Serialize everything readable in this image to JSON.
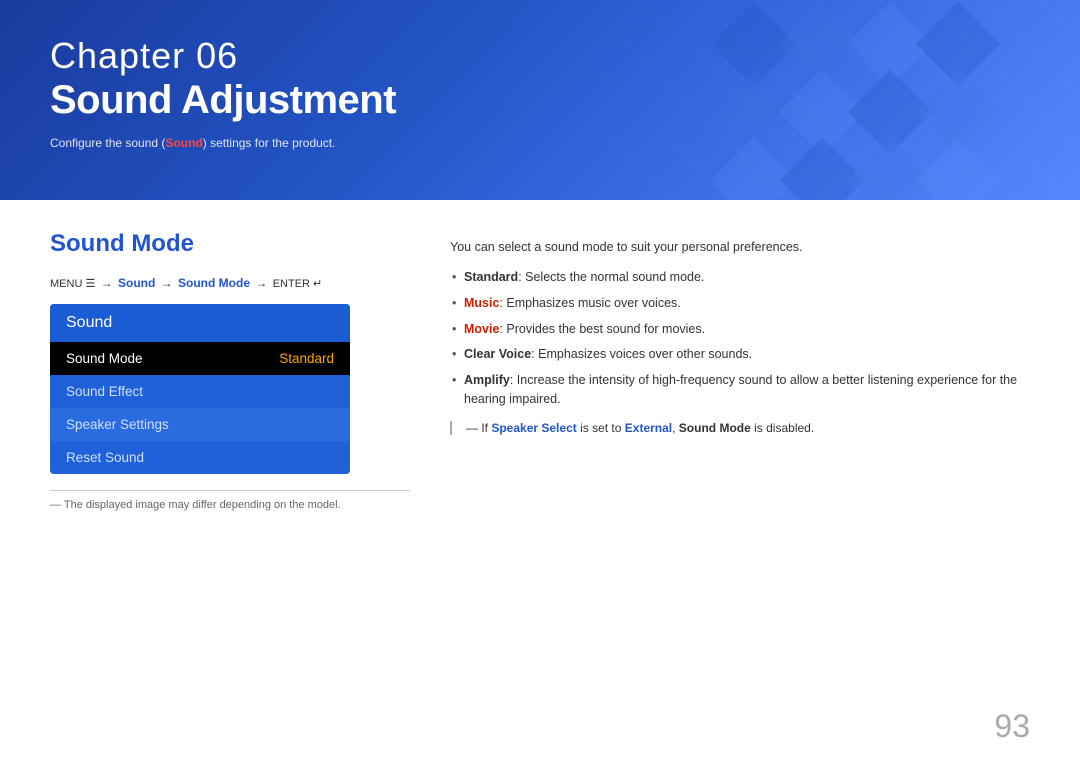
{
  "header": {
    "chapter_label": "Chapter  06",
    "chapter_title": "Sound Adjustment",
    "subtitle_text": "Configure the sound (",
    "subtitle_highlight": "Sound",
    "subtitle_end": ") settings for the product."
  },
  "section": {
    "title": "Sound Mode",
    "menu_path_prefix": "MENU",
    "menu_path_arrow1": "→",
    "menu_path_sound": "Sound",
    "menu_path_arrow2": "→",
    "menu_path_mode": "Sound Mode",
    "menu_path_arrow3": "→",
    "menu_path_enter": "ENTER"
  },
  "tv_menu": {
    "header": "Sound",
    "items": [
      {
        "label": "Sound Mode",
        "value": "Standard",
        "selected": true
      },
      {
        "label": "Sound Effect",
        "value": "",
        "selected": false
      },
      {
        "label": "Speaker Settings",
        "value": "",
        "selected": false
      },
      {
        "label": "Reset Sound",
        "value": "",
        "selected": false
      }
    ]
  },
  "footnote": "The displayed image may differ depending on the model.",
  "right_column": {
    "intro": "You can select a sound mode to suit your personal preferences.",
    "bullets": [
      {
        "term": "Standard",
        "term_style": "bold",
        "text": ": Selects the normal sound mode."
      },
      {
        "term": "Music",
        "term_style": "red",
        "text": ": Emphasizes music over voices."
      },
      {
        "term": "Movie",
        "term_style": "red",
        "text": ": Provides the best sound for movies."
      },
      {
        "term": "Clear Voice",
        "term_style": "bold",
        "text": ": Emphasizes voices over other sounds."
      },
      {
        "term": "Amplify",
        "term_style": "bold",
        "text": ": Increase the intensity of high-frequency sound to allow a better listening experience for the hearing impaired."
      }
    ],
    "note_prefix": "― If ",
    "note_highlight1": "Speaker Select",
    "note_middle": " is set to ",
    "note_highlight2": "External",
    "note_bold": ", Sound Mode",
    "note_suffix": " is disabled."
  },
  "page_number": "93"
}
